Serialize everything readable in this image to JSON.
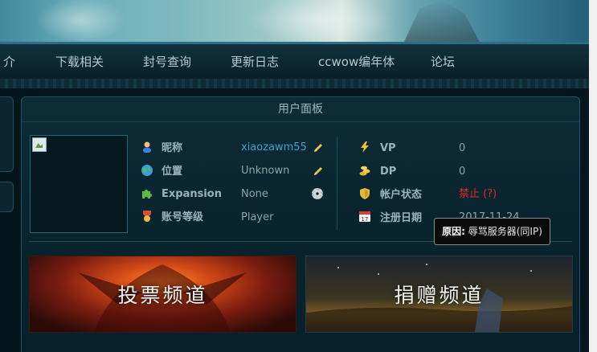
{
  "nav": {
    "items": [
      "介",
      "下载相关",
      "封号查询",
      "更新日志",
      "ccwow编年体",
      "论坛"
    ]
  },
  "panel": {
    "title": "用户面板"
  },
  "user": {
    "nickname_label": "昵称",
    "nickname_value": "xiaozawm55",
    "location_label": "位置",
    "location_value": "Unknown",
    "expansion_label": "Expansion",
    "expansion_value": "None",
    "level_label": "账号等级",
    "level_value": "Player"
  },
  "account": {
    "vp_label": "VP",
    "vp_value": "0",
    "dp_label": "DP",
    "dp_value": "0",
    "status_label": "帐户状态",
    "status_value": "禁止 (?)",
    "reg_label": "注册日期",
    "reg_value": "2017-11-24"
  },
  "tooltip": {
    "prefix": "原因:",
    "text": "辱骂服务器(同IP)"
  },
  "banners": {
    "vote": "投票频道",
    "donate": "捐赠频道"
  },
  "colors": {
    "accent": "#2b6e86",
    "link": "#3aa6c8",
    "banned": "#e02a2a"
  }
}
